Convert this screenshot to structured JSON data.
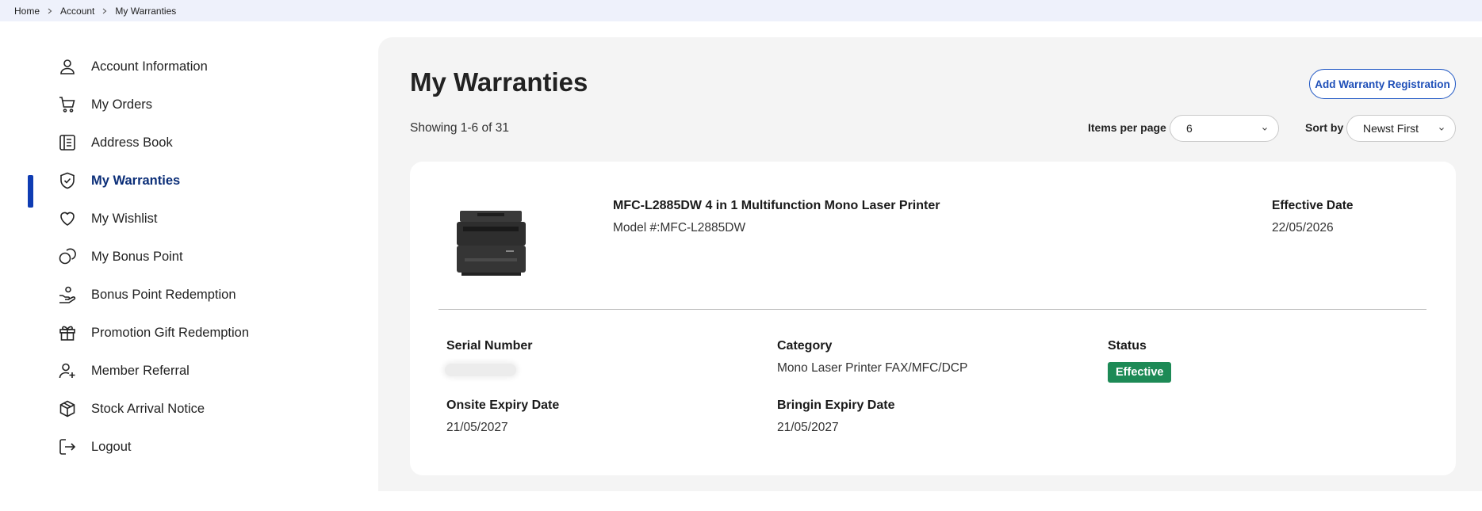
{
  "breadcrumb": {
    "items": [
      "Home",
      "Account",
      "My Warranties"
    ]
  },
  "sidebar": {
    "items": [
      {
        "label": "Account Information",
        "icon": "user-icon"
      },
      {
        "label": "My Orders",
        "icon": "cart-icon"
      },
      {
        "label": "Address Book",
        "icon": "address-book-icon"
      },
      {
        "label": "My Warranties",
        "icon": "shield-check-icon",
        "active": true
      },
      {
        "label": "My Wishlist",
        "icon": "heart-icon"
      },
      {
        "label": "My Bonus Point",
        "icon": "coins-icon"
      },
      {
        "label": "Bonus Point Redemption",
        "icon": "hand-coin-icon"
      },
      {
        "label": "Promotion Gift Redemption",
        "icon": "gift-icon"
      },
      {
        "label": "Member Referral",
        "icon": "user-plus-icon"
      },
      {
        "label": "Stock Arrival Notice",
        "icon": "box-icon"
      },
      {
        "label": "Logout",
        "icon": "logout-icon"
      }
    ]
  },
  "main": {
    "title": "My Warranties",
    "add_button": "Add Warranty Registration",
    "showing": "Showing 1-6 of 31",
    "items_per_page_label": "Items per page",
    "items_per_page_value": "6",
    "sort_label": "Sort by",
    "sort_value": "Newst First"
  },
  "warranty": {
    "product_name": "MFC-L2885DW 4 in 1 Multifunction Mono Laser Printer",
    "model": "Model #:MFC-L2885DW",
    "effective_date_label": "Effective Date",
    "effective_date": "22/05/2026",
    "serial_label": "Serial Number",
    "category_label": "Category",
    "category": "Mono Laser Printer FAX/MFC/DCP",
    "status_label": "Status",
    "status": "Effective",
    "onsite_label": "Onsite Expiry Date",
    "onsite_date": "21/05/2027",
    "bringin_label": "Bringin Expiry Date",
    "bringin_date": "21/05/2027"
  },
  "colors": {
    "accent": "#0f3cb3",
    "active_text": "#0b2e78",
    "status_badge": "#1d8a56",
    "button_border": "#1e56c4"
  }
}
